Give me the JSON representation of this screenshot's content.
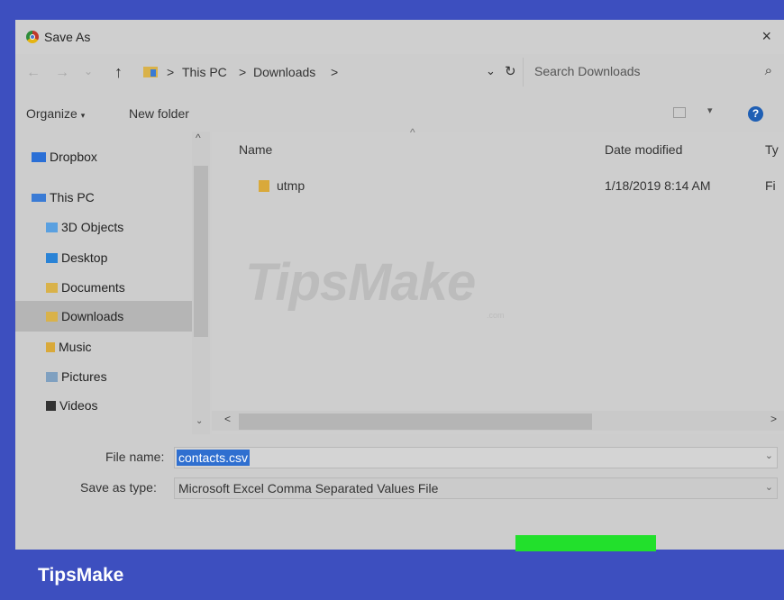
{
  "window": {
    "title": "Save As",
    "close_glyph": "×"
  },
  "navigation": {
    "back_glyph": "←",
    "forward_glyph": "→",
    "recent_glyph": "⌄",
    "up_glyph": "↑",
    "path": [
      "This PC",
      "Downloads"
    ],
    "separator": ">",
    "dropdown_glyph": "⌄",
    "refresh_glyph": "↻",
    "search_placeholder": "Search Downloads",
    "search_glyph": "⌕"
  },
  "toolbar": {
    "organize_label": "Organize",
    "organize_chev": "▾",
    "new_folder_label": "New folder",
    "view_chev": "▾",
    "help_glyph": "?"
  },
  "sidebar": {
    "items": [
      {
        "label": "Dropbox",
        "icon": "dropbox-icon",
        "color": "#2a6fd6"
      },
      {
        "label": "This PC",
        "icon": "pc-icon",
        "color": "#3a7bd5"
      },
      {
        "label": "3D Objects",
        "icon": "3d-objects-icon",
        "color": "#5aa0e0"
      },
      {
        "label": "Desktop",
        "icon": "desktop-icon",
        "color": "#2a83d6"
      },
      {
        "label": "Documents",
        "icon": "documents-icon",
        "color": "#d9b24a"
      },
      {
        "label": "Downloads",
        "icon": "downloads-icon",
        "color": "#d9b24a",
        "selected": true
      },
      {
        "label": "Music",
        "icon": "music-icon",
        "color": "#d9a93a"
      },
      {
        "label": "Pictures",
        "icon": "pictures-icon",
        "color": "#7fa0c0"
      },
      {
        "label": "Videos",
        "icon": "videos-icon",
        "color": "#333333"
      }
    ],
    "scroll_up_glyph": "^",
    "scroll_down_glyph": "⌄"
  },
  "file_list": {
    "columns": [
      "Name",
      "Date modified",
      "Ty"
    ],
    "sort_glyph": "^",
    "rows": [
      {
        "name": "utmp",
        "date_modified": "1/18/2019 8:14 AM",
        "type": "Fi"
      }
    ],
    "hscroll_left": "<",
    "hscroll_right": ">"
  },
  "save_fields": {
    "file_name_label": "File name:",
    "file_name_value": "contacts.csv",
    "file_name_chev": "⌄",
    "save_type_label": "Save as type:",
    "save_type_value": "Microsoft Excel Comma Separated Values File",
    "save_type_chev": "⌄"
  },
  "watermark": {
    "text": "TipsMake",
    "suffix": ".com"
  },
  "brand": {
    "text": "TipsMake"
  },
  "colors": {
    "frame": "#3d4fbf",
    "highlight": "#22e02c",
    "selection": "#2f6fd0"
  }
}
